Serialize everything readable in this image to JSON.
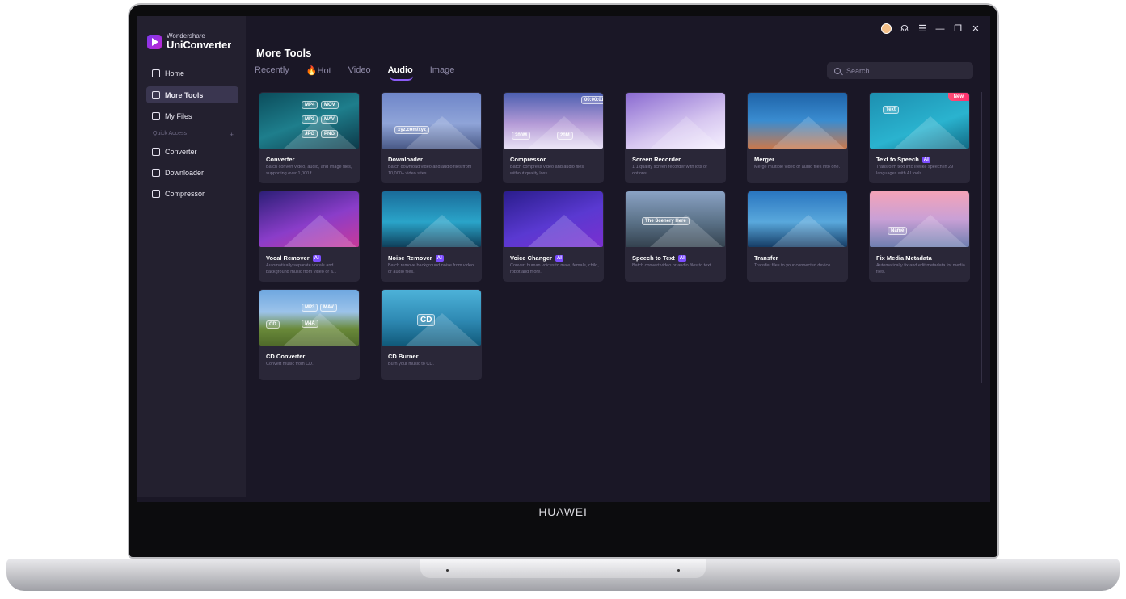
{
  "app": {
    "brand_small": "Wondershare",
    "brand_name": "UniConverter"
  },
  "sidebar": {
    "items": [
      {
        "label": "Home",
        "icon": "home-icon"
      },
      {
        "label": "More Tools",
        "icon": "toolbox-icon",
        "active": true
      },
      {
        "label": "My Files",
        "icon": "file-icon"
      }
    ],
    "quick_access_label": "Quick Access",
    "quick_access_add": "+",
    "quick_items": [
      {
        "label": "Converter",
        "icon": "convert-icon"
      },
      {
        "label": "Downloader",
        "icon": "download-icon"
      },
      {
        "label": "Compressor",
        "icon": "compress-icon"
      }
    ]
  },
  "titlebar": {
    "icons": [
      "user-avatar-icon",
      "headset-icon",
      "menu-icon",
      "minimize-icon",
      "restore-icon",
      "close-icon"
    ],
    "glyphs": [
      "",
      "☊",
      "☰",
      "—",
      "❐",
      "✕"
    ]
  },
  "main": {
    "title": "More Tools",
    "tabs": [
      {
        "label": "Recently"
      },
      {
        "label": "Hot",
        "prefix": "🔥"
      },
      {
        "label": "Video"
      },
      {
        "label": "Audio",
        "active": true
      },
      {
        "label": "Image"
      }
    ],
    "search_placeholder": "Search"
  },
  "tools": [
    {
      "title": "Converter",
      "desc": "Batch convert video, audio, and image files, supporting over 1,000 f...",
      "ai": false,
      "chips": [
        "MP4",
        "MOV",
        "MP3",
        "MAV",
        "JPG",
        "PNG"
      ]
    },
    {
      "title": "Downloader",
      "desc": "Batch download video and audio files from 10,000+ video sites.",
      "ai": false,
      "chips": [
        "xyz.com/xyz"
      ]
    },
    {
      "title": "Compressor",
      "desc": "Batch compress video and audio files without quality loss.",
      "ai": false,
      "chips": [
        "200M",
        "20M",
        "00:00:01"
      ]
    },
    {
      "title": "Screen Recorder",
      "desc": "1:1 quality screen recorder with lots of options.",
      "ai": false,
      "chips": []
    },
    {
      "title": "Merger",
      "desc": "Merge multiple video or audio files into one.",
      "ai": false,
      "chips": []
    },
    {
      "title": "Text to Speech",
      "desc": "Transform text into lifelike speech in 29 languages with AI tools.",
      "ai": true,
      "new": "New",
      "chips": [
        "Text"
      ]
    },
    {
      "title": "Vocal Remover",
      "desc": "Automatically separate vocals and background music from video or a...",
      "ai": true,
      "chips": []
    },
    {
      "title": "Noise Remover",
      "desc": "Batch remove background noise from video or audio files.",
      "ai": true,
      "chips": []
    },
    {
      "title": "Voice Changer",
      "desc": "Convert human voices to male, female, child, robot and more.",
      "ai": true,
      "chips": []
    },
    {
      "title": "Speech to Text",
      "desc": "Batch convert video or audio files to text.",
      "ai": true,
      "chips": [
        "The Scenery Here"
      ]
    },
    {
      "title": "Transfer",
      "desc": "Transfer files to your connected device.",
      "ai": false,
      "chips": []
    },
    {
      "title": "Fix Media Metadata",
      "desc": "Automatically fix and edit metadata for media files.",
      "ai": false,
      "chips": [
        "Name"
      ]
    },
    {
      "title": "CD Converter",
      "desc": "Convert music from CD.",
      "ai": false,
      "chips": [
        "MP3",
        "MAV",
        "M4A",
        "CD"
      ]
    },
    {
      "title": "CD Burner",
      "desc": "Burn your music to CD.",
      "ai": false,
      "chips": [
        "CD"
      ]
    }
  ],
  "ai_badge_label": "AI",
  "device_brand": "HUAWEI",
  "colors": {
    "accent": "#8b5cf6",
    "ai_badge": "#7c4dff",
    "new_badge": "#ff2f6e",
    "background": "#1a1726",
    "sidebar": "#23202f",
    "card": "#2a2738"
  }
}
